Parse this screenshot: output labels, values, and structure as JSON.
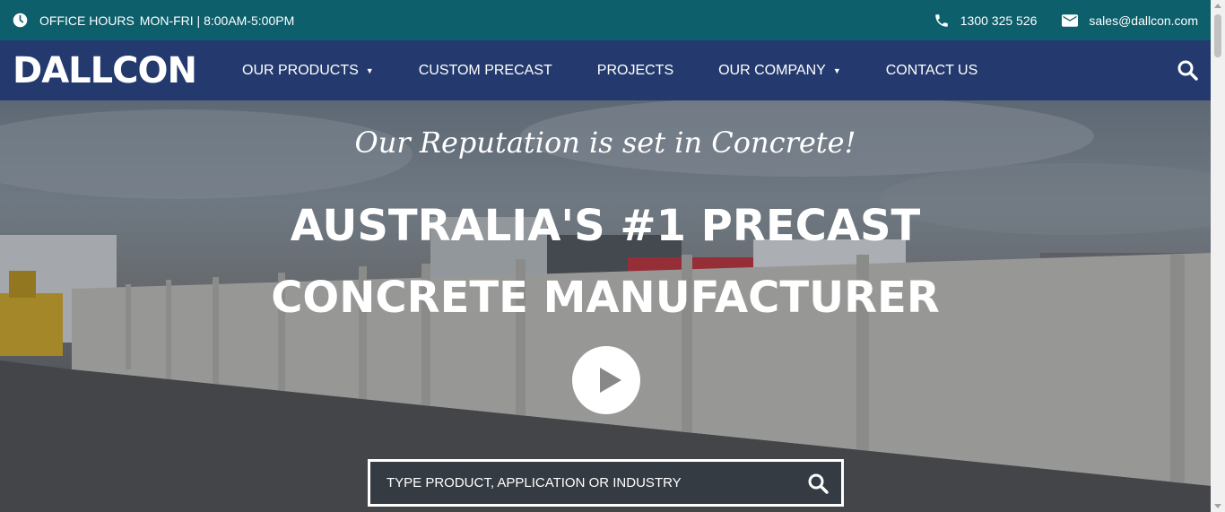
{
  "topbar": {
    "hours_label": "OFFICE HOURS",
    "hours_value": "MON-FRI | 8:00AM-5:00PM",
    "phone": "1300 325 526",
    "email": "sales@dallcon.com",
    "icons": [
      "clock-icon",
      "phone-icon",
      "mail-icon"
    ],
    "background": "#0c5f6b"
  },
  "navbar": {
    "logo_text": "DALLCON",
    "background": "#243a6e",
    "items": [
      {
        "label": "OUR PRODUCTS",
        "has_dropdown": true
      },
      {
        "label": "CUSTOM PRECAST",
        "has_dropdown": false
      },
      {
        "label": "PROJECTS",
        "has_dropdown": false
      },
      {
        "label": "OUR COMPANY",
        "has_dropdown": true
      },
      {
        "label": "CONTACT US",
        "has_dropdown": false
      }
    ],
    "caret": "▼"
  },
  "hero": {
    "tagline": "Our Reputation is set in Concrete!",
    "headline_line1": "AUSTRALIA'S #1 PRECAST",
    "headline_line2": "CONCRETE MANUFACTURER",
    "search_placeholder": "TYPE PRODUCT, APPLICATION OR INDUSTRY"
  }
}
